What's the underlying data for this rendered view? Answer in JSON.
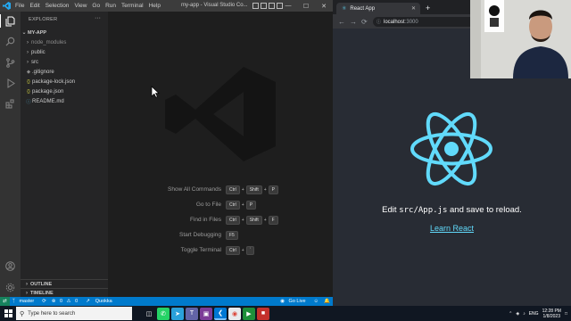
{
  "vscode": {
    "menu": [
      "File",
      "Edit",
      "Selection",
      "View",
      "Go",
      "Run",
      "Terminal",
      "Help"
    ],
    "title": "my-app - Visual Studio Co...",
    "window_controls": [
      "minimize",
      "maximize",
      "close"
    ],
    "explorer_label": "EXPLORER",
    "explorer_more": "···",
    "project": "MY-APP",
    "tree": [
      {
        "name": "node_modules",
        "kind": "folder",
        "dim": true
      },
      {
        "name": "public",
        "kind": "folder",
        "dim": false
      },
      {
        "name": "src",
        "kind": "folder",
        "dim": false
      },
      {
        "name": ".gitignore",
        "kind": "file",
        "dim": false
      },
      {
        "name": "package-lock.json",
        "kind": "json",
        "dim": false
      },
      {
        "name": "package.json",
        "kind": "json",
        "dim": false
      },
      {
        "name": "README.md",
        "kind": "md",
        "dim": false
      }
    ],
    "outline_label": "OUTLINE",
    "timeline_label": "TIMELINE",
    "shortcuts": [
      {
        "label": "Show All Commands",
        "keys": [
          "Ctrl",
          "+",
          "Shift",
          "+",
          "P"
        ]
      },
      {
        "label": "Go to File",
        "keys": [
          "Ctrl",
          "+",
          "P"
        ]
      },
      {
        "label": "Find in Files",
        "keys": [
          "Ctrl",
          "+",
          "Shift",
          "+",
          "F"
        ]
      },
      {
        "label": "Start Debugging",
        "keys": [
          "F5"
        ]
      },
      {
        "label": "Toggle Terminal",
        "keys": [
          "Ctrl",
          "+",
          "`"
        ]
      }
    ],
    "status": {
      "branch": "master",
      "errors": "0",
      "warnings": "0",
      "quokka": "Quokka",
      "golive": "Go Live"
    },
    "accent": "#007acc"
  },
  "browser": {
    "tab_title": "React App",
    "url_host": "localhost",
    "url_port": ":3000",
    "edit_prefix": "Edit ",
    "edit_code": "src/App.js",
    "edit_suffix": " and save to reload.",
    "link": "Learn React",
    "react_color": "#61dafb"
  },
  "taskbar": {
    "search_placeholder": "Type here to search",
    "lang": "ENG",
    "time": "12:28 PM",
    "date": "1/8/2023"
  }
}
